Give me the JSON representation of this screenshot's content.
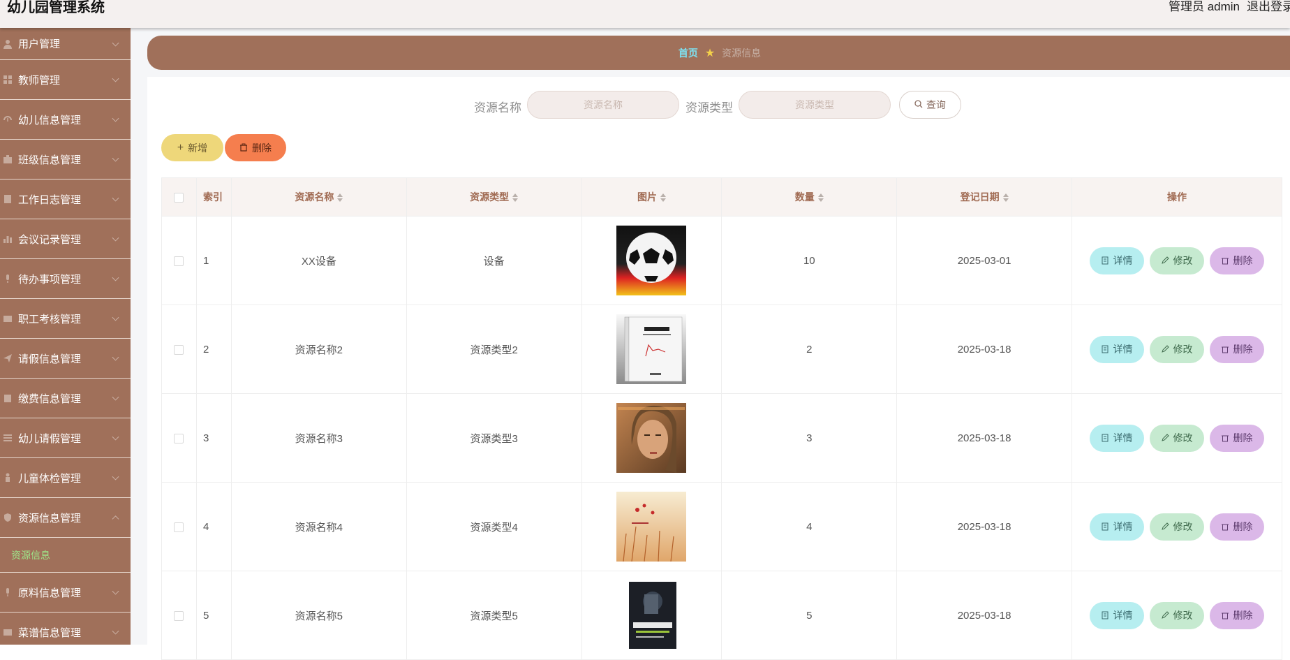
{
  "app": {
    "title": "幼儿园管理系统",
    "user": "管理员 admin",
    "logout": "退出登录"
  },
  "sidebar": {
    "items": [
      {
        "label": "用户管理",
        "icon": "user-icon"
      },
      {
        "label": "教师管理",
        "icon": "grid-icon"
      },
      {
        "label": "幼儿信息管理",
        "icon": "dashboard-icon"
      },
      {
        "label": "班级信息管理",
        "icon": "briefcase-icon"
      },
      {
        "label": "工作日志管理",
        "icon": "document-icon"
      },
      {
        "label": "会议记录管理",
        "icon": "bar-chart-icon"
      },
      {
        "label": "待办事项管理",
        "icon": "microphone-icon"
      },
      {
        "label": "职工考核管理",
        "icon": "id-card-icon"
      },
      {
        "label": "请假信息管理",
        "icon": "send-icon"
      },
      {
        "label": "缴费信息管理",
        "icon": "clipboard-icon"
      },
      {
        "label": "幼儿请假管理",
        "icon": "list-icon"
      },
      {
        "label": "儿童体检管理",
        "icon": "person-icon"
      },
      {
        "label": "资源信息管理",
        "icon": "shield-icon"
      },
      {
        "label": "原料信息管理",
        "icon": "mic-icon"
      },
      {
        "label": "菜谱信息管理",
        "icon": "card-icon"
      }
    ],
    "sub_item": "资源信息"
  },
  "breadcrumb": {
    "home": "首页",
    "current": "资源信息"
  },
  "search": {
    "name_label": "资源名称",
    "name_placeholder": "资源名称",
    "type_label": "资源类型",
    "type_placeholder": "资源类型",
    "query_button": "查询"
  },
  "toolbar": {
    "add_label": "新增",
    "delete_label": "删除"
  },
  "table": {
    "headers": {
      "index": "索引",
      "name": "资源名称",
      "type": "资源类型",
      "image": "图片",
      "quantity": "数量",
      "date": "登记日期",
      "ops": "操作"
    },
    "rows": [
      {
        "index": "1",
        "name": "XX设备",
        "type": "设备",
        "quantity": "10",
        "date": "2025-03-01",
        "image": "soccer-ball-image"
      },
      {
        "index": "2",
        "name": "资源名称2",
        "type": "资源类型2",
        "quantity": "2",
        "date": "2025-03-18",
        "image": "physics-book-image"
      },
      {
        "index": "3",
        "name": "资源名称3",
        "type": "资源类型3",
        "quantity": "3",
        "date": "2025-03-18",
        "image": "magazine-cover-image"
      },
      {
        "index": "4",
        "name": "资源名称4",
        "type": "资源类型4",
        "quantity": "4",
        "date": "2025-03-18",
        "image": "flower-book-image"
      },
      {
        "index": "5",
        "name": "资源名称5",
        "type": "资源类型5",
        "quantity": "5",
        "date": "2025-03-18",
        "image": "training-book-image"
      }
    ],
    "ops": {
      "detail": "详情",
      "edit": "修改",
      "delete": "删除"
    }
  },
  "colors": {
    "sidebar": "#a0705a",
    "accent": "#7ee0f0",
    "add": "#eed77a",
    "delete": "#f57e4e"
  }
}
